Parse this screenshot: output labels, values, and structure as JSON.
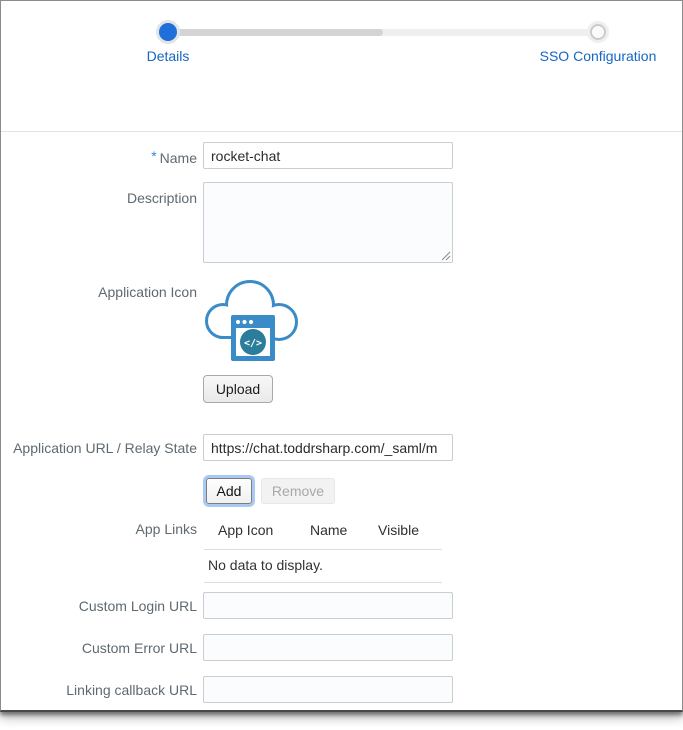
{
  "stepper": {
    "progress_percent": 50,
    "steps": [
      {
        "label": "Details",
        "state": "active"
      },
      {
        "label": "SSO Configuration",
        "state": "upcoming"
      }
    ]
  },
  "form": {
    "name": {
      "label": "Name",
      "required_marker": "*",
      "value": "rocket-chat"
    },
    "description": {
      "label": "Description",
      "value": ""
    },
    "application_icon": {
      "label": "Application Icon",
      "upload_label": "Upload",
      "icon": "cloud-code-app-icon",
      "code_glyph": "</>"
    },
    "application_url": {
      "label": "Application URL / Relay State",
      "value": "https://chat.toddrsharp.com/_saml/m"
    },
    "actions": {
      "add": "Add",
      "remove": "Remove"
    },
    "app_links": {
      "label": "App Links",
      "columns": [
        "App Icon",
        "Name",
        "Visible"
      ],
      "empty_message": "No data to display."
    },
    "custom_login_url": {
      "label": "Custom Login URL",
      "value": ""
    },
    "custom_error_url": {
      "label": "Custom Error URL",
      "value": ""
    },
    "linking_callback_url": {
      "label": "Linking callback URL",
      "value": ""
    }
  },
  "colors": {
    "step_dot_blue": "#1e6fd9",
    "step_label_blue": "#1666c5",
    "icon_blue": "#3a8cc9",
    "icon_teal": "#2c7d9c",
    "focus_ring_blue": "#a9c9f3"
  }
}
